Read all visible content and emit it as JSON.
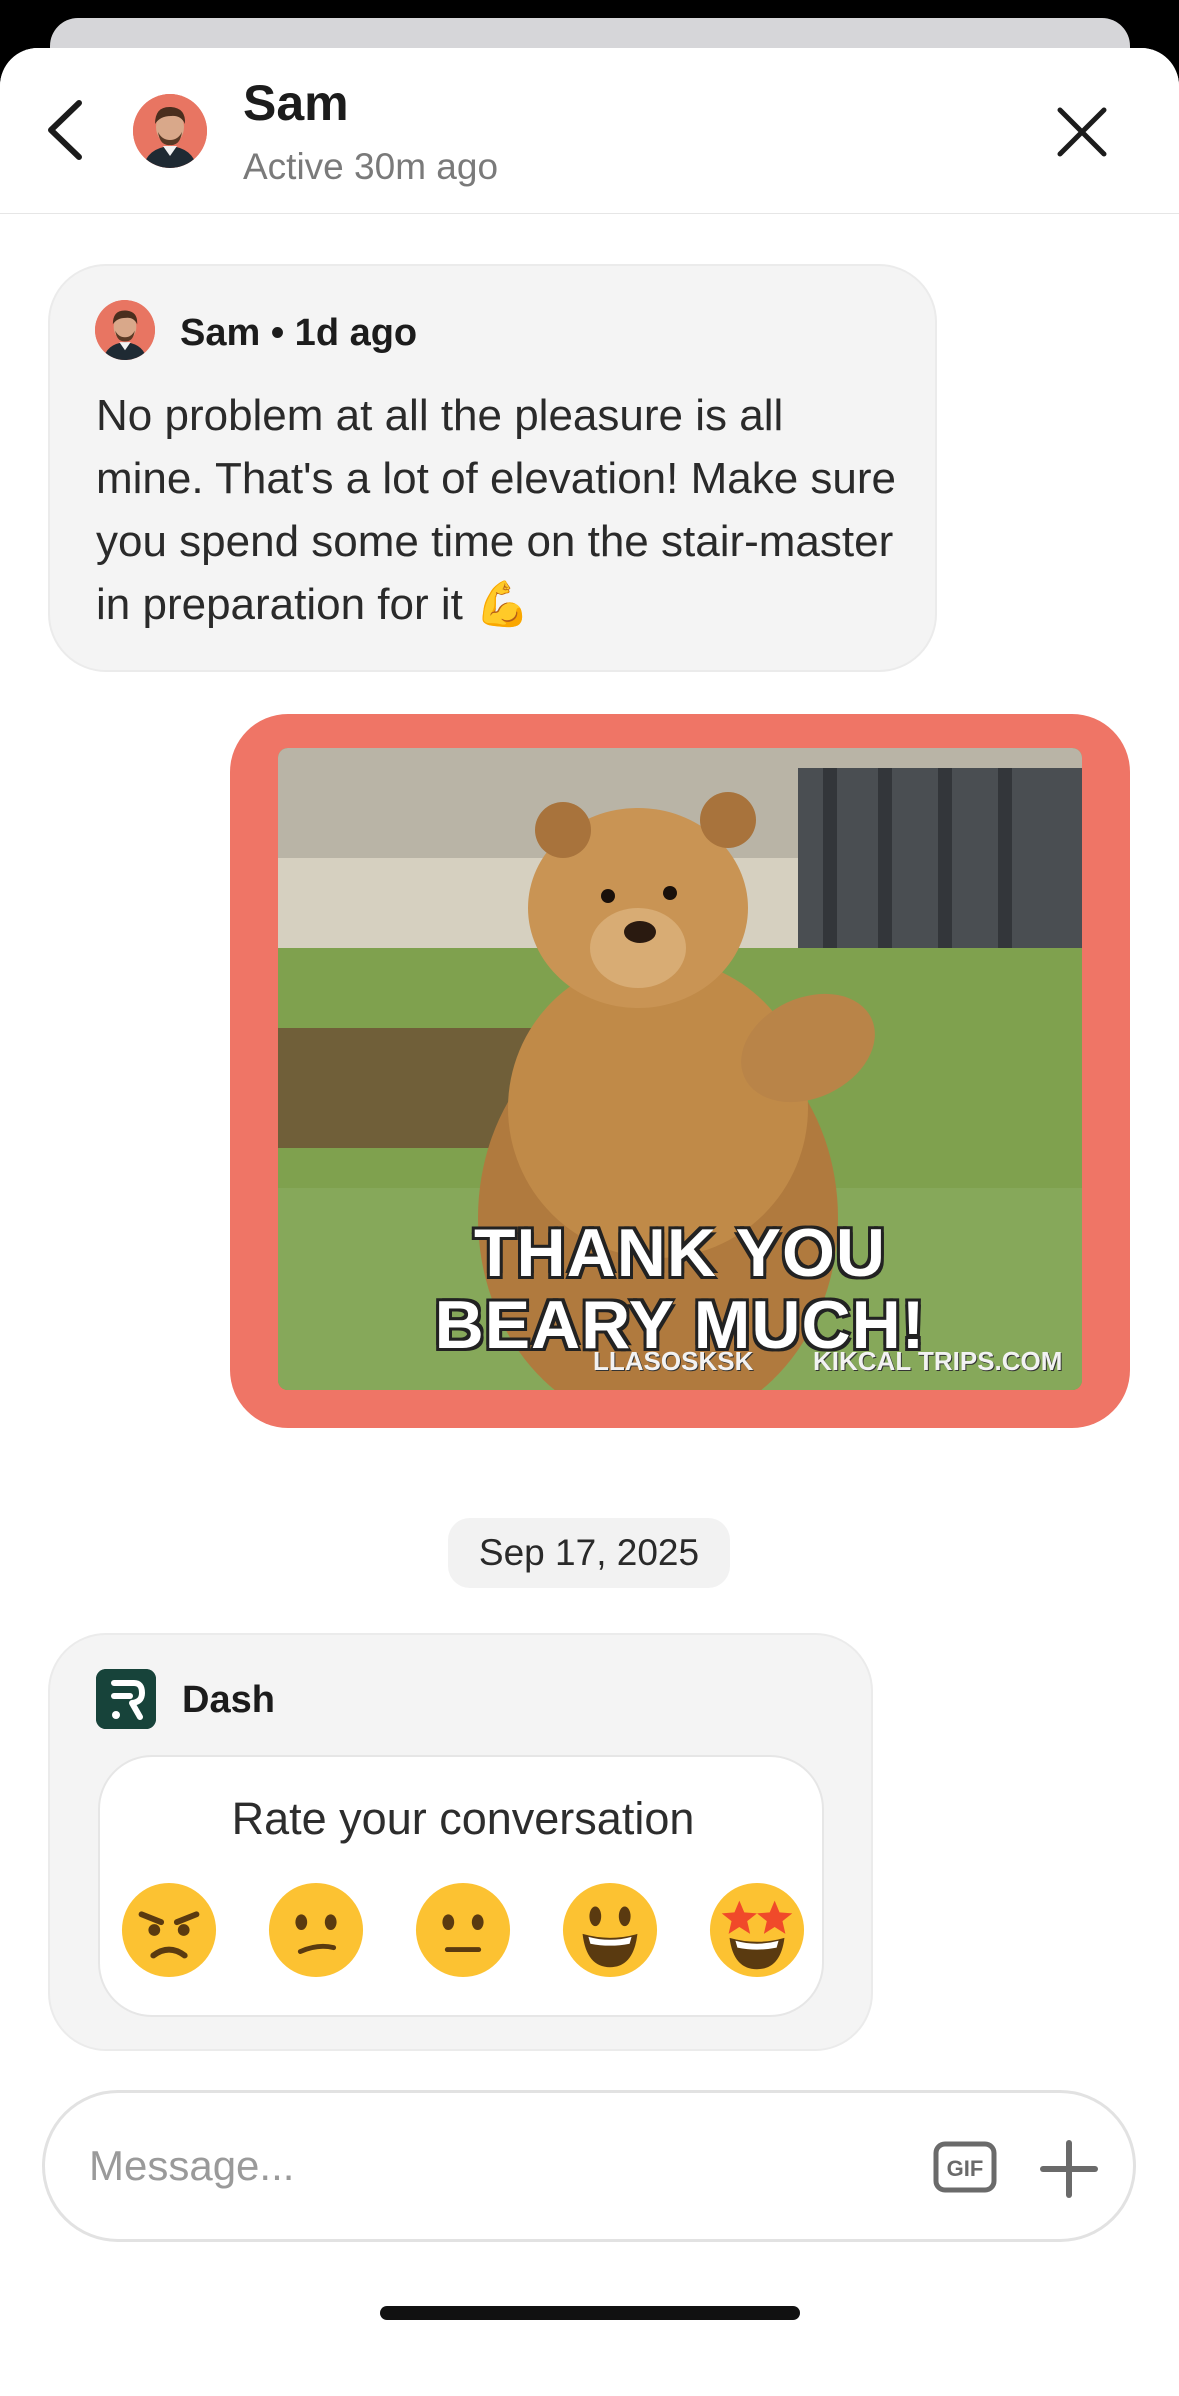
{
  "header": {
    "back_icon": "chevron-left-icon",
    "contact_name": "Sam",
    "status": "Active 30m ago",
    "close_icon": "close-icon"
  },
  "messages": [
    {
      "sender": "Sam",
      "meta": "Sam • 1d ago",
      "text": "No problem at all the pleasure is all mine. That's a lot of elevation! Make sure you spend some time on the stair-master in preparation for it 💪"
    },
    {
      "type": "gif",
      "caption_line1": "THANK YOU",
      "caption_line2": "BEARY MUCH!",
      "watermark_left": "LLASOSKSK",
      "watermark_right": "KIKCAL TRIPS.COM",
      "frame_color": "#ef7566"
    }
  ],
  "date_divider": "Sep 17, 2025",
  "dash_card": {
    "sender": "Dash",
    "title": "Rate your conversation",
    "ratings": [
      "angry-face-icon",
      "confused-face-icon",
      "neutral-face-icon",
      "smiling-face-icon",
      "star-struck-face-icon"
    ]
  },
  "composer": {
    "placeholder": "Message...",
    "gif_label": "GIF",
    "plus_icon": "plus-icon"
  },
  "colors": {
    "accent": "#ef7566",
    "bubble_bg": "#f4f4f4",
    "dash_logo": "#17433a"
  }
}
